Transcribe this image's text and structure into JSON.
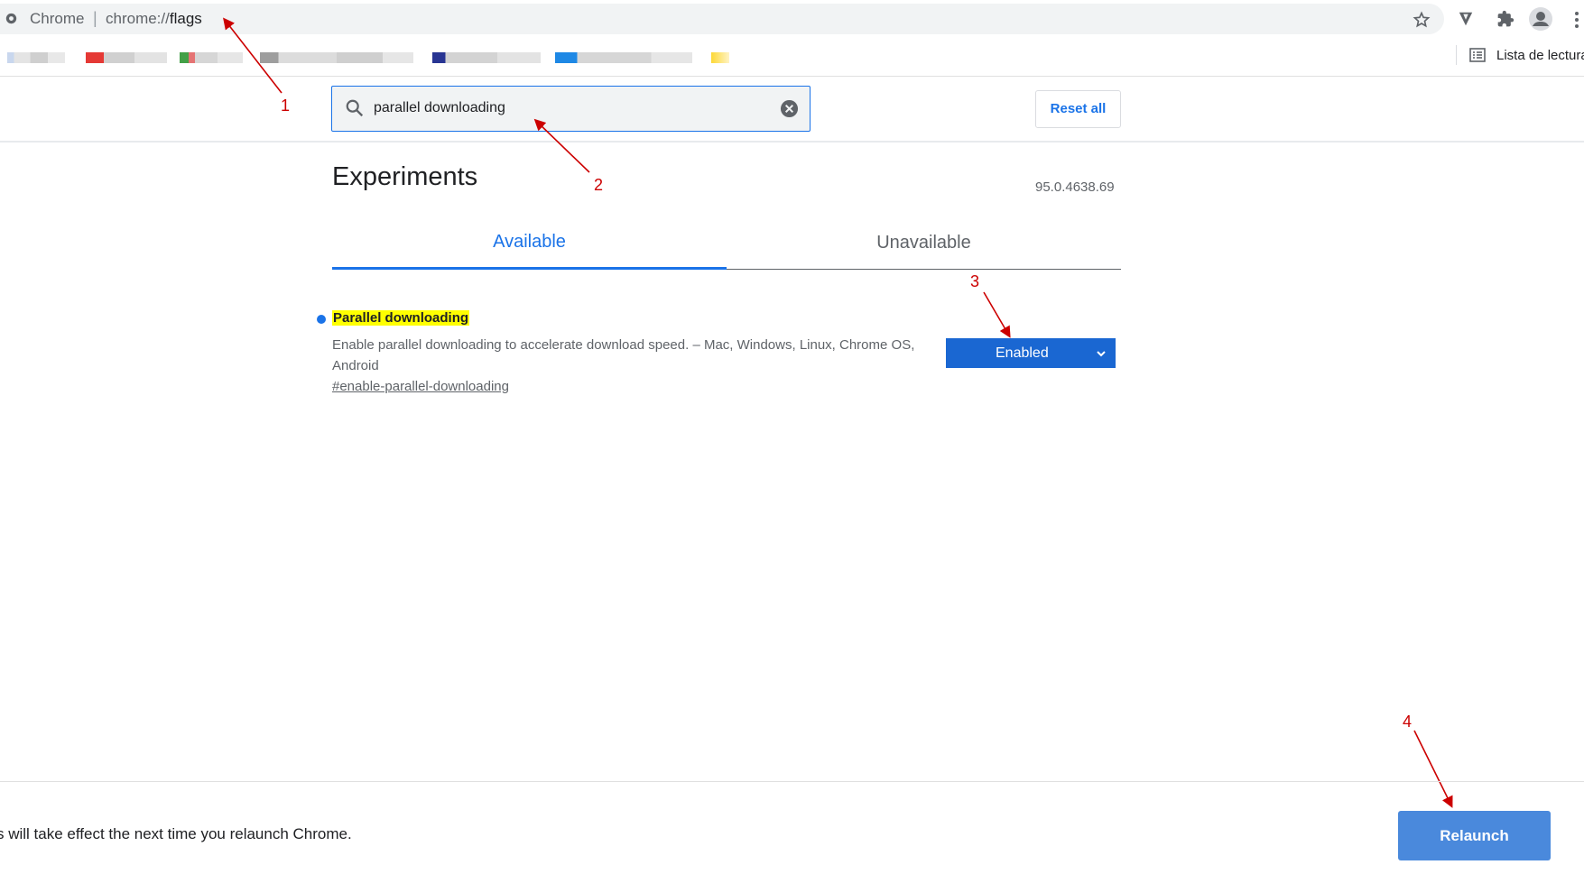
{
  "browser": {
    "site_name": "Chrome",
    "url_separator": "|",
    "url_scheme": "chrome://",
    "url_host": "flags",
    "reading_list_label": "Lista de lectura",
    "icons": [
      "star-icon",
      "extension-v-icon",
      "puzzle-icon",
      "profile-icon",
      "menu-icon",
      "reading-list-icon"
    ]
  },
  "search": {
    "value": "parallel downloading",
    "reset_label": "Reset all"
  },
  "page": {
    "title": "Experiments",
    "version": "95.0.4638.69"
  },
  "tabs": [
    {
      "label": "Available",
      "active": true
    },
    {
      "label": "Unavailable",
      "active": false
    }
  ],
  "experiment": {
    "title": "Parallel downloading",
    "description": "Enable parallel downloading to accelerate download speed. – Mac, Windows, Linux, Chrome OS, Android",
    "link": "#enable-parallel-downloading",
    "selected_option": "Enabled"
  },
  "annotations": [
    "1",
    "2",
    "3",
    "4"
  ],
  "footer": {
    "message": "s will take effect the next time you relaunch Chrome.",
    "relaunch_label": "Relaunch"
  },
  "colors": {
    "accent": "#1a73e8",
    "select_bg": "#1a67d2",
    "highlight": "#ffff00",
    "annotation": "#cc0000",
    "relaunch_bg": "#4a89dc"
  }
}
